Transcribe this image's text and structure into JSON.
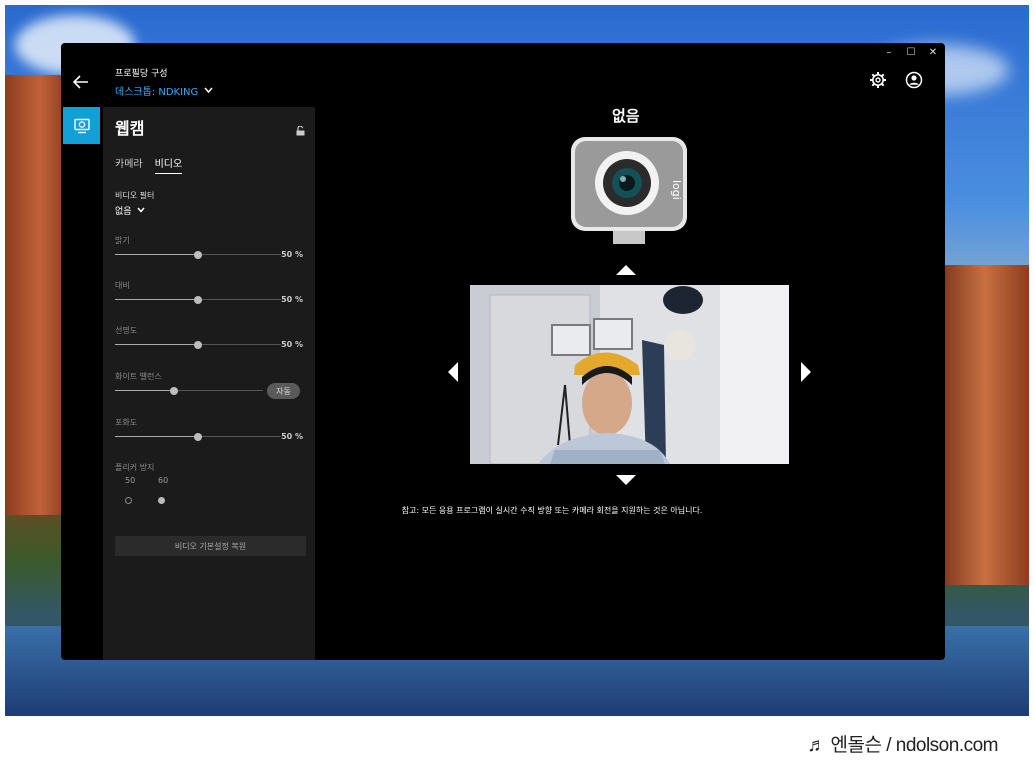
{
  "window": {
    "controls": [
      "–",
      "☐",
      "✕"
    ]
  },
  "header": {
    "title": "프로필당 구성",
    "profile": "데스크톱: NDKING"
  },
  "panel": {
    "title": "웹캠",
    "tabs": [
      {
        "label": "카메라",
        "active": false
      },
      {
        "label": "비디오",
        "active": true
      }
    ],
    "video_filter": {
      "label": "비디오 필터",
      "value": "없음"
    },
    "sliders": [
      {
        "label": "밝기",
        "value": 50,
        "value_text": "50 %"
      },
      {
        "label": "대비",
        "value": 50,
        "value_text": "50 %"
      },
      {
        "label": "선명도",
        "value": 50,
        "value_text": "50 %"
      },
      {
        "label": "화이트 밸런스",
        "value": 40,
        "button": "자동"
      },
      {
        "label": "포화도",
        "value": 50,
        "value_text": "50 %"
      }
    ],
    "flicker": {
      "label": "플리커 방지",
      "options": [
        {
          "label": "50",
          "selected": false
        },
        {
          "label": "60",
          "selected": true
        }
      ]
    },
    "reset_button": "비디오 기본설정 복원"
  },
  "main": {
    "title": "없음",
    "note": "참고: 모든 응용 프로그램이 실시간 수직 방향 또는 카메라 회전을 지원하는 것은 아닙니다.",
    "camera_brand": "logi"
  },
  "watermark": "♬ 엔돌슨 / ndolson.com",
  "colors": {
    "accent": "#11a0d8",
    "link": "#3fa9f5",
    "panel_bg": "#1b1b1b",
    "window_bg": "#000000"
  }
}
